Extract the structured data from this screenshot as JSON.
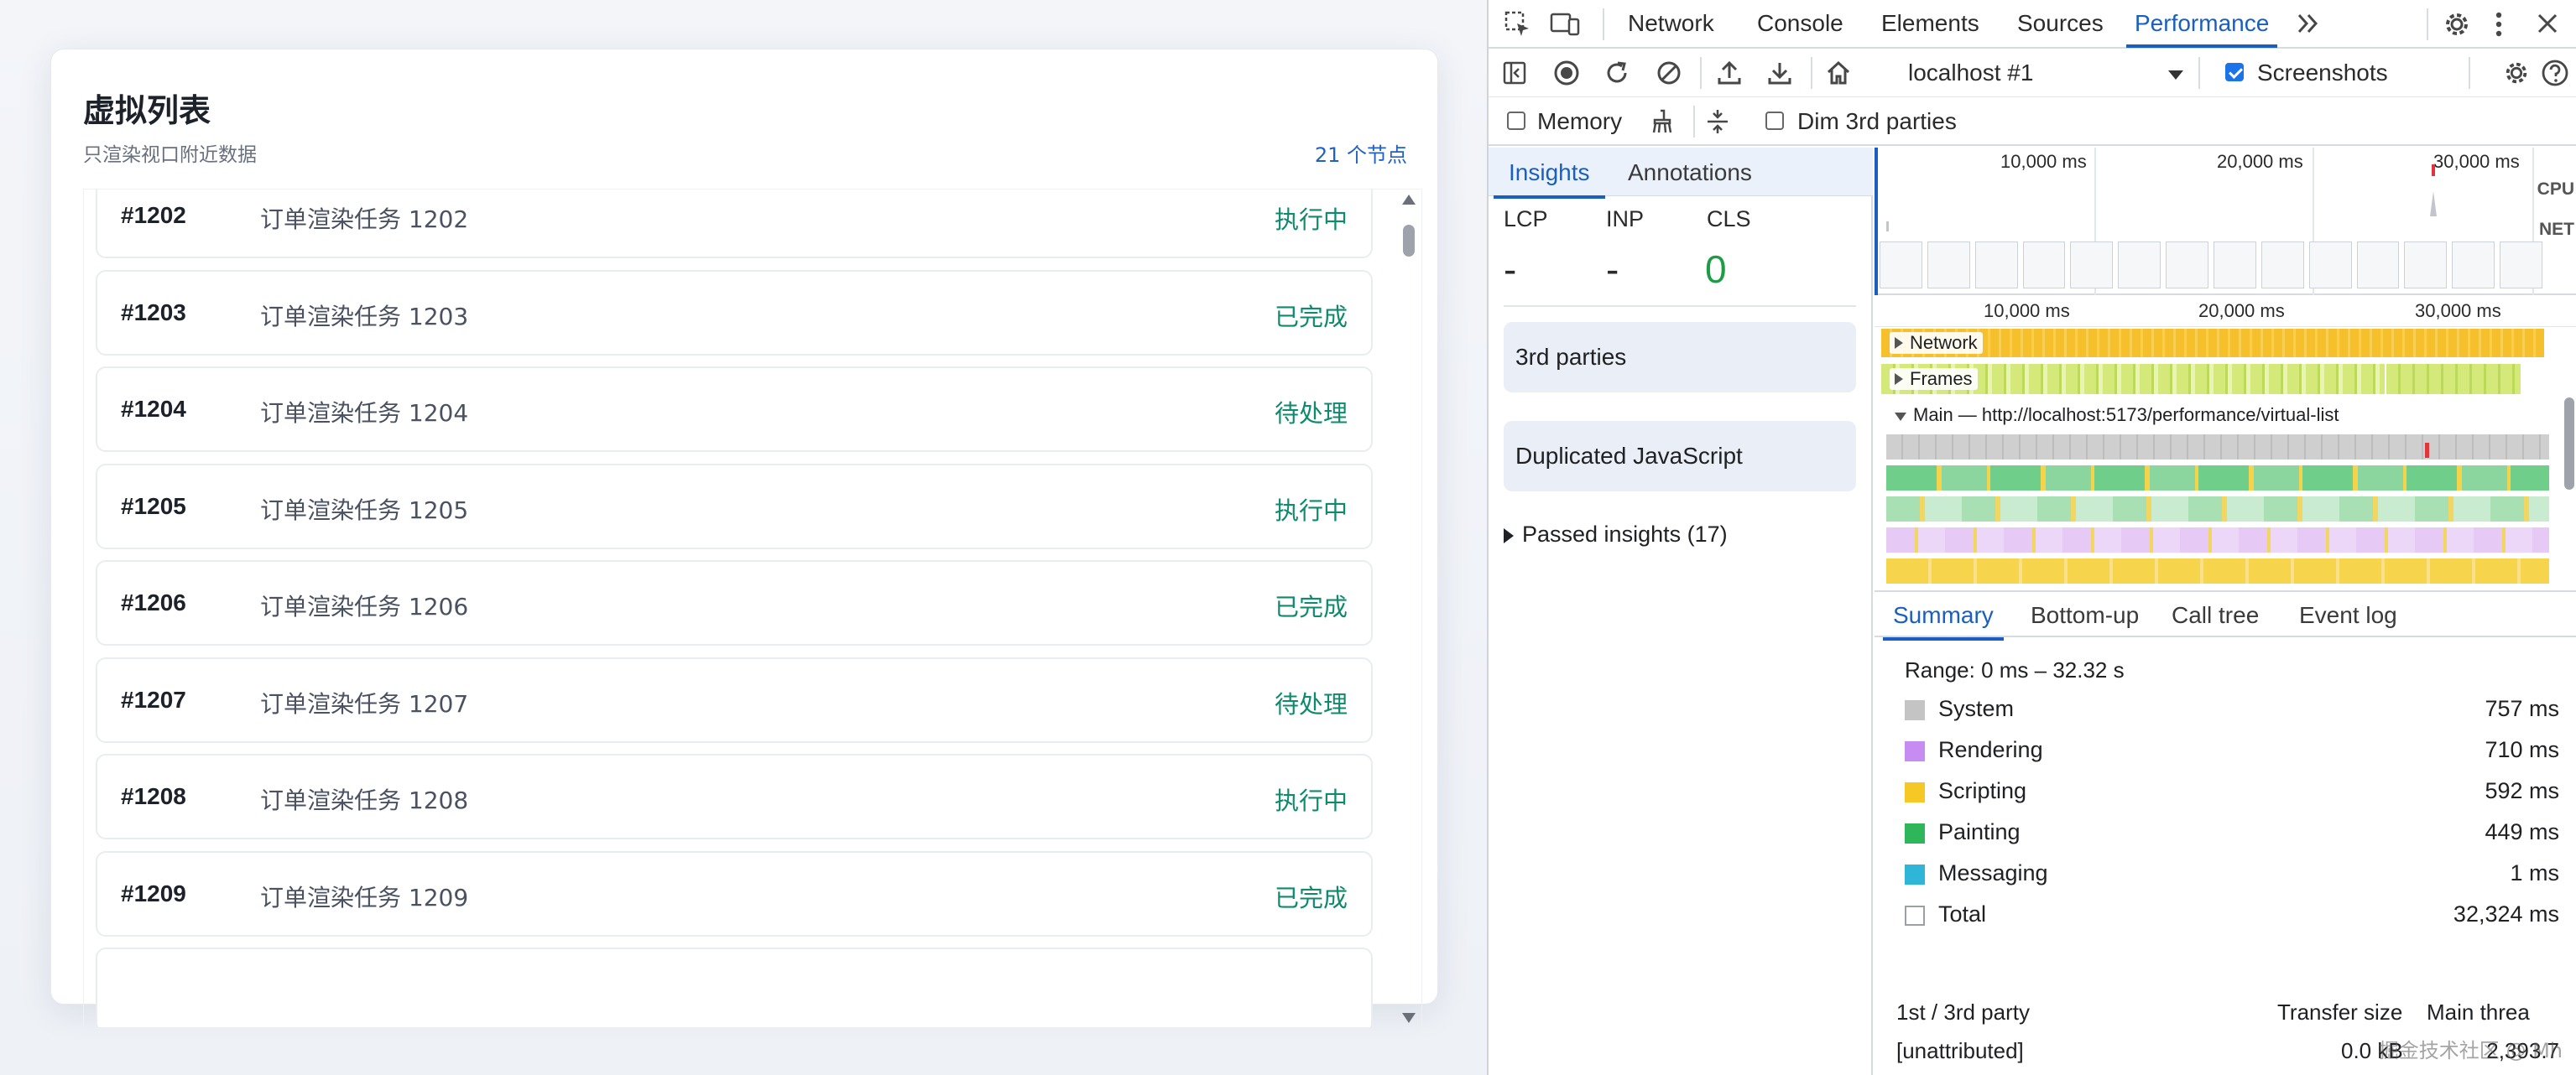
{
  "page": {
    "title": "虚拟列表",
    "subtitle": "只渲染视口附近数据",
    "node_count": "21 个节点",
    "rows": [
      {
        "id": "#1202",
        "name": "订单渲染任务 1202",
        "status": "执行中"
      },
      {
        "id": "#1203",
        "name": "订单渲染任务 1203",
        "status": "已完成"
      },
      {
        "id": "#1204",
        "name": "订单渲染任务 1204",
        "status": "待处理"
      },
      {
        "id": "#1205",
        "name": "订单渲染任务 1205",
        "status": "执行中"
      },
      {
        "id": "#1206",
        "name": "订单渲染任务 1206",
        "status": "已完成"
      },
      {
        "id": "#1207",
        "name": "订单渲染任务 1207",
        "status": "待处理"
      },
      {
        "id": "#1208",
        "name": "订单渲染任务 1208",
        "status": "执行中"
      },
      {
        "id": "#1209",
        "name": "订单渲染任务 1209",
        "status": "已完成"
      }
    ]
  },
  "devtools": {
    "tabs": [
      "Network",
      "Console",
      "Elements",
      "Sources",
      "Performance"
    ],
    "active_tab": "Performance",
    "more_tabs_icon": "double-chevron-right-icon",
    "target": "localhost #1",
    "screenshots_label": "Screenshots",
    "screenshots_checked": true,
    "memory_label": "Memory",
    "memory_checked": false,
    "dim_3p_label": "Dim 3rd parties",
    "dim_3p_checked": false,
    "sidebar": {
      "tabs": [
        "Insights",
        "Annotations"
      ],
      "metrics": [
        {
          "label": "LCP",
          "value": "-"
        },
        {
          "label": "INP",
          "value": "-"
        },
        {
          "label": "CLS",
          "value": "0"
        }
      ],
      "insights": [
        "3rd parties",
        "Duplicated JavaScript"
      ],
      "passed": "Passed insights (17)"
    },
    "timeline": {
      "overview_ticks": [
        "10,000 ms",
        "20,000 ms",
        "30,000 ms"
      ],
      "side_labels": [
        "CPU",
        "NET"
      ],
      "ruler_ticks": [
        "10,000 ms",
        "20,000 ms",
        "30,000 ms"
      ],
      "tracks": {
        "network": "Network",
        "frames": "Frames",
        "main": "Main — http://localhost:5173/performance/virtual-list"
      }
    },
    "bottom": {
      "tabs": [
        "Summary",
        "Bottom-up",
        "Call tree",
        "Event log"
      ],
      "range": "Range: 0 ms – 32.32 s",
      "summary": [
        {
          "name": "System",
          "value": "757 ms",
          "color": "#c4c4c4"
        },
        {
          "name": "Rendering",
          "value": "710 ms",
          "color": "#c68cf2"
        },
        {
          "name": "Scripting",
          "value": "592 ms",
          "color": "#f5c825"
        },
        {
          "name": "Painting",
          "value": "449 ms",
          "color": "#2fb65a"
        },
        {
          "name": "Messaging",
          "value": "1 ms",
          "color": "#2eb5d8"
        },
        {
          "name": "Total",
          "value": "32,324 ms",
          "color": "#ffffff"
        }
      ],
      "table_headers": [
        "1st / 3rd party",
        "Transfer size",
        "Main threa"
      ],
      "table_rows": [
        {
          "party": "[unattributed]",
          "transfer": "0.0 kB",
          "main": "2,393.7"
        }
      ]
    },
    "watermark": "掘金技术社区 @ Mh"
  },
  "colors": {
    "accent": "#1a5fbf",
    "status_green": "#0f8a6c",
    "good_metric": "#1e9b45"
  }
}
